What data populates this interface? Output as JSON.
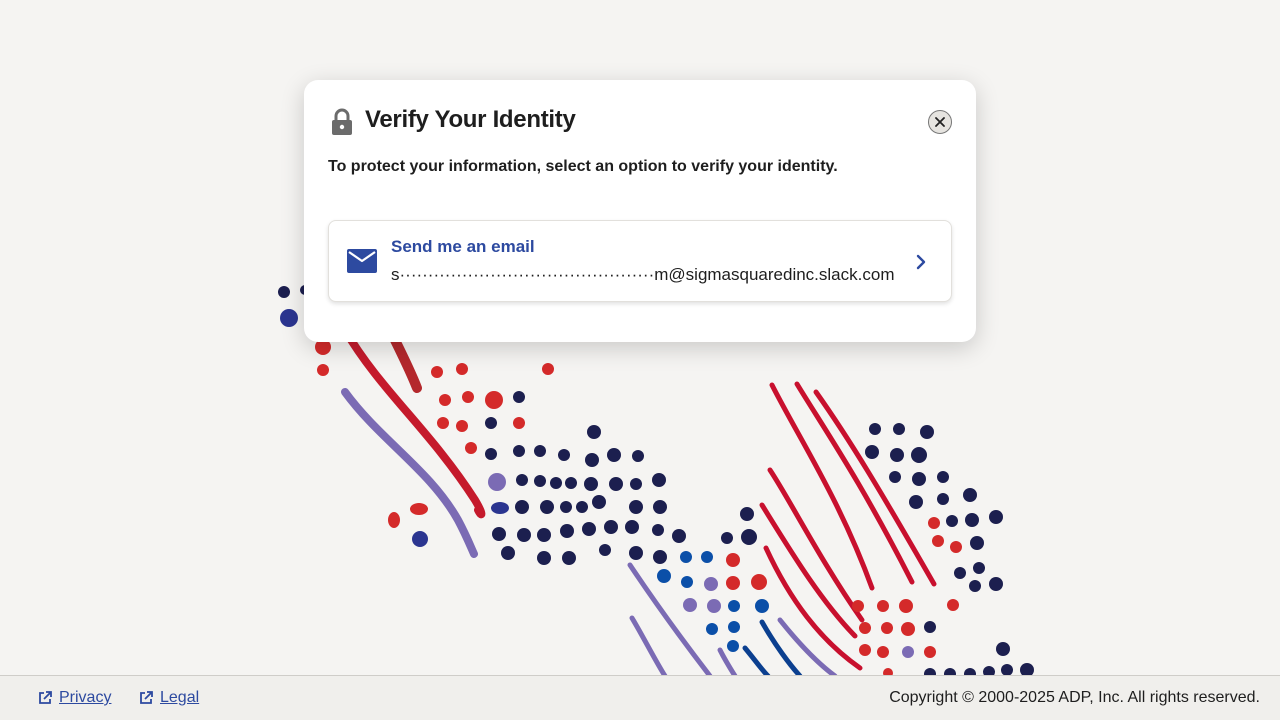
{
  "dialog": {
    "title": "Verify Your Identity",
    "instructions": "To protect your information, select an option to verify your identity.",
    "lock_icon": "lock-icon",
    "close_icon": "close-icon",
    "options": [
      {
        "label": "Send me an email",
        "value": "s·············································m@sigmasquaredinc.slack.com",
        "icon": "mail-icon",
        "action_icon": "chevron-right-icon"
      }
    ]
  },
  "footer": {
    "links": [
      {
        "label": "Privacy",
        "icon": "external-link-icon"
      },
      {
        "label": "Legal",
        "icon": "external-link-icon"
      }
    ],
    "copyright": "Copyright © 2000-2025 ADP, Inc. All rights reserved."
  },
  "colors": {
    "background": "#f5f4f2",
    "accent_blue": "#2d4aa0",
    "art_navy": "#1c1f4f",
    "art_red": "#d4162f",
    "art_purple": "#7b6bb4",
    "art_blue": "#0b4fa8"
  }
}
